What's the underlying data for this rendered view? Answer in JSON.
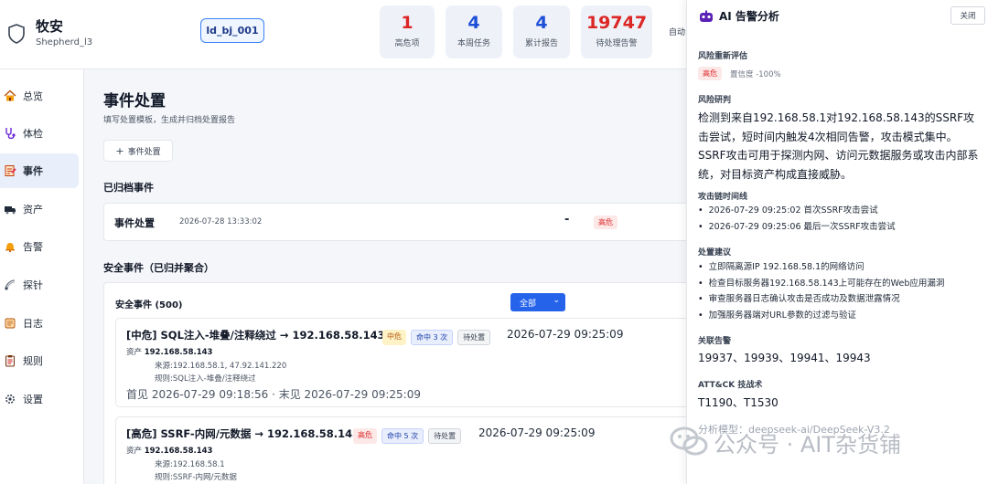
{
  "brand": {
    "name": "牧安",
    "user": "Shepherd_l3"
  },
  "id_badge": "ld_bj_001",
  "stats": [
    {
      "value": "1",
      "label": "高危项",
      "color": "#dc2626"
    },
    {
      "value": "4",
      "label": "本周任务",
      "color": "#1d4ed8"
    },
    {
      "value": "4",
      "label": "累计报告",
      "color": "#1d4ed8"
    },
    {
      "value": "19747",
      "label": "待处理告警",
      "color": "#dc2626"
    }
  ],
  "auto_label": "自动",
  "sidebar": {
    "items": [
      {
        "label": "总览",
        "icon": "home-icon"
      },
      {
        "label": "体检",
        "icon": "stethoscope-icon"
      },
      {
        "label": "事件",
        "icon": "document-icon",
        "active": true
      },
      {
        "label": "资产",
        "icon": "truck-icon"
      },
      {
        "label": "告警",
        "icon": "bell-icon"
      },
      {
        "label": "探针",
        "icon": "satellite-icon"
      },
      {
        "label": "日志",
        "icon": "scroll-icon"
      },
      {
        "label": "规则",
        "icon": "clipboard-icon"
      },
      {
        "label": "设置",
        "icon": "gear-icon"
      }
    ]
  },
  "main": {
    "title": "事件处置",
    "subtitle": "填写处置模板，生成并归档处置报告",
    "add_button": "事件处置",
    "archived_title": "已归档事件",
    "archived": {
      "title": "事件处置",
      "date": "2026-07-28 13:33:02",
      "dash": "-",
      "level": "高危"
    },
    "security_title": "安全事件（已归并聚合）",
    "panel_header": "安全事件 (500)",
    "filter_label": "全部",
    "events": [
      {
        "title": "[中危] SQL注入-堆叠/注释绕过 → 192.168.58.143",
        "level": "中危",
        "hits": "命中 3 次",
        "status": "待处置",
        "time": "2026-07-29 09:25:09",
        "asset_label": "资产",
        "asset": "192.168.58.143",
        "source": "来源:192.168.58.1, 47.92.141.220",
        "rule": "规则:SQL注入-堆叠/注释绕过",
        "seen": "首见 2026-07-29 09:18:56 · 末见 2026-07-29 09:25:09"
      },
      {
        "title": "[高危] SSRF-内网/元数据 → 192.168.58.143",
        "level": "高危",
        "hits": "命中 5 次",
        "status": "待处置",
        "time": "2026-07-29 09:25:09",
        "asset_label": "资产",
        "asset": "192.168.58.143",
        "source": "来源:192.168.58.1",
        "rule": "规则:SSRF-内网/元数据"
      }
    ]
  },
  "ai_panel": {
    "title": "AI 告警分析",
    "close": "关闭",
    "risk_heading": "风险重新评估",
    "risk_level": "高危",
    "confidence": "置信度 -100%",
    "judge_heading": "风险研判",
    "judge_text": "检测到来自192.168.58.1对192.168.58.143的SSRF攻击尝试，短时间内触发4次相同告警，攻击模式集中。SSRF攻击可用于探测内网、访问元数据服务或攻击内部系统，对目标资产构成直接威胁。",
    "timeline_heading": "攻击链时间线",
    "timeline": [
      "2026-07-29 09:25:02 首次SSRF攻击尝试",
      "2026-07-29 09:25:06 最后一次SSRF攻击尝试"
    ],
    "advice_heading": "处置建议",
    "advice": [
      "立即隔离源IP 192.168.58.1的网络访问",
      "检查目标服务器192.168.58.143上可能存在的Web应用漏洞",
      "审查服务器日志确认攻击是否成功及数据泄露情况",
      "加强服务器端对URL参数的过滤与验证"
    ],
    "related_heading": "关联告警",
    "related": "19937、19939、19941、19943",
    "attck_heading": "ATT&CK 技战术",
    "attck": "T1190、T1530",
    "model": "分析模型：deepseek-ai/DeepSeek-V3.2"
  },
  "watermark": "公众号 · AIT杂货铺"
}
